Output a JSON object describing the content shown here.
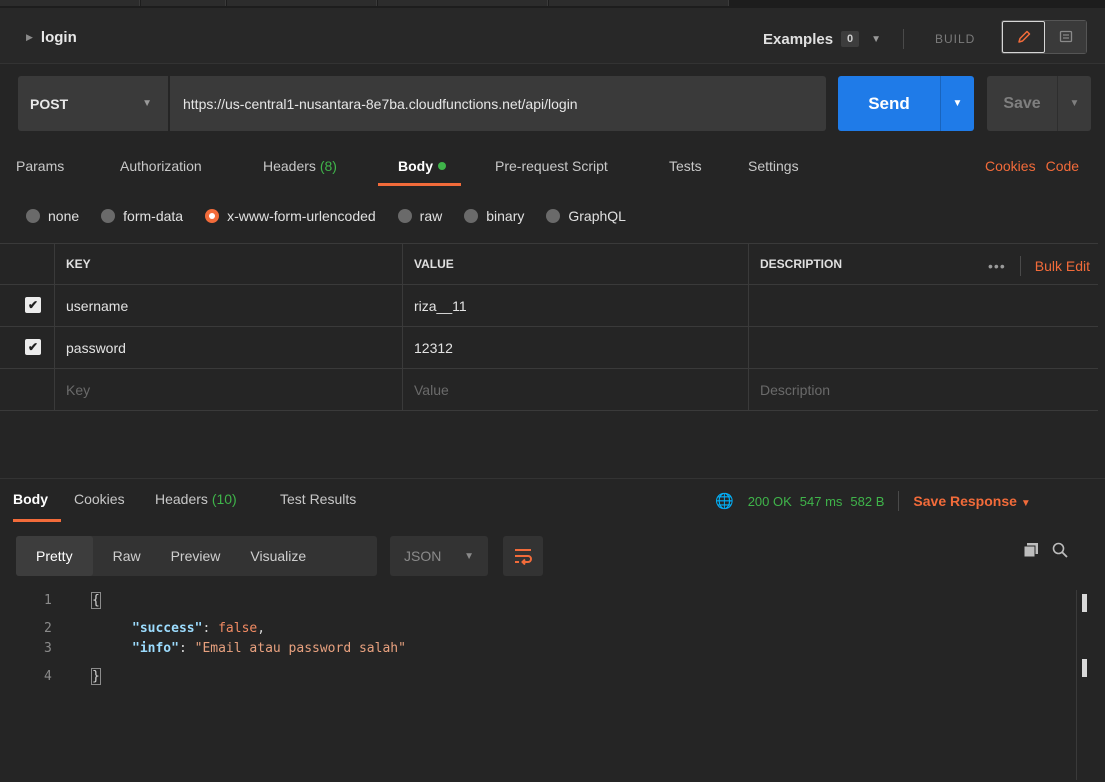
{
  "header": {
    "request_name": "login",
    "examples_label": "Examples",
    "examples_count": "0",
    "build_label": "BUILD"
  },
  "url_bar": {
    "method": "POST",
    "url": "https://us-central1-nusantara-8e7ba.cloudfunctions.net/api/login",
    "send_label": "Send",
    "save_label": "Save"
  },
  "request_tabs": {
    "params": "Params",
    "authorization": "Authorization",
    "headers": "Headers",
    "headers_count": "(8)",
    "body": "Body",
    "pre_request": "Pre-request Script",
    "tests": "Tests",
    "settings": "Settings",
    "cookies": "Cookies",
    "code": "Code"
  },
  "body_types": {
    "none": "none",
    "form_data": "form-data",
    "urlencoded": "x-www-form-urlencoded",
    "raw": "raw",
    "binary": "binary",
    "graphql": "GraphQL",
    "selected": "x-www-form-urlencoded"
  },
  "params_table": {
    "headers": {
      "key": "KEY",
      "value": "VALUE",
      "description": "DESCRIPTION",
      "more": "•••",
      "bulk_edit": "Bulk Edit"
    },
    "rows": [
      {
        "checked": true,
        "key": "username",
        "value": "riza__11",
        "description": ""
      },
      {
        "checked": true,
        "key": "password",
        "value": "12312",
        "description": ""
      }
    ],
    "placeholders": {
      "key": "Key",
      "value": "Value",
      "description": "Description"
    }
  },
  "response": {
    "tabs": {
      "body": "Body",
      "cookies": "Cookies",
      "headers": "Headers",
      "headers_count": "(10)",
      "test_results": "Test Results"
    },
    "status": "200 OK",
    "time": "547 ms",
    "size": "582 B",
    "save_response": "Save Response",
    "views": {
      "pretty": "Pretty",
      "raw": "Raw",
      "preview": "Preview",
      "visualize": "Visualize"
    },
    "format": "JSON",
    "code_lines": [
      {
        "n": "1",
        "open": "{"
      },
      {
        "n": "2",
        "key": "\"success\"",
        "colon": ": ",
        "val": "false",
        "tail": ","
      },
      {
        "n": "3",
        "key": "\"info\"",
        "colon": ": ",
        "str": "\"Email atau password salah\""
      },
      {
        "n": "4",
        "close": "}"
      }
    ]
  },
  "colors": {
    "accent": "#f26b3a",
    "send": "#1f7be8",
    "success": "#3fb44a"
  },
  "icons": [
    "triangle-right-icon",
    "pencil-icon",
    "comment-icon",
    "chevron-down-icon",
    "globe-lock-icon",
    "wrap-lines-icon",
    "copy-icon",
    "search-icon"
  ]
}
